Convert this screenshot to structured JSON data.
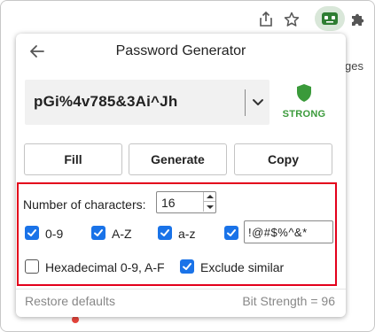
{
  "browser": {
    "background_text_right": "ges"
  },
  "popup": {
    "title": "Password Generator",
    "password": "pGi%4v785&3Ai^Jh",
    "strength": "STRONG",
    "buttons": {
      "fill": "Fill",
      "generate": "Generate",
      "copy": "Copy"
    },
    "options": {
      "num_chars_label": "Number of characters:",
      "num_chars_value": "16",
      "digits": {
        "label": "0-9",
        "checked": true
      },
      "uppercase": {
        "label": "A-Z",
        "checked": true
      },
      "lowercase": {
        "label": "a-z",
        "checked": true
      },
      "symbols": {
        "checked": true,
        "value": "!@#$%^&*"
      },
      "hex": {
        "label": "Hexadecimal 0-9, A-F",
        "checked": false
      },
      "exclude_similar": {
        "label": "Exclude similar",
        "checked": true
      }
    },
    "footer": {
      "restore_defaults": "Restore defaults",
      "bit_strength": "Bit Strength = 96"
    }
  },
  "colors": {
    "accent": "#1a73e8",
    "strong_green": "#3a9a3a",
    "highlight_red": "#e3001b"
  }
}
